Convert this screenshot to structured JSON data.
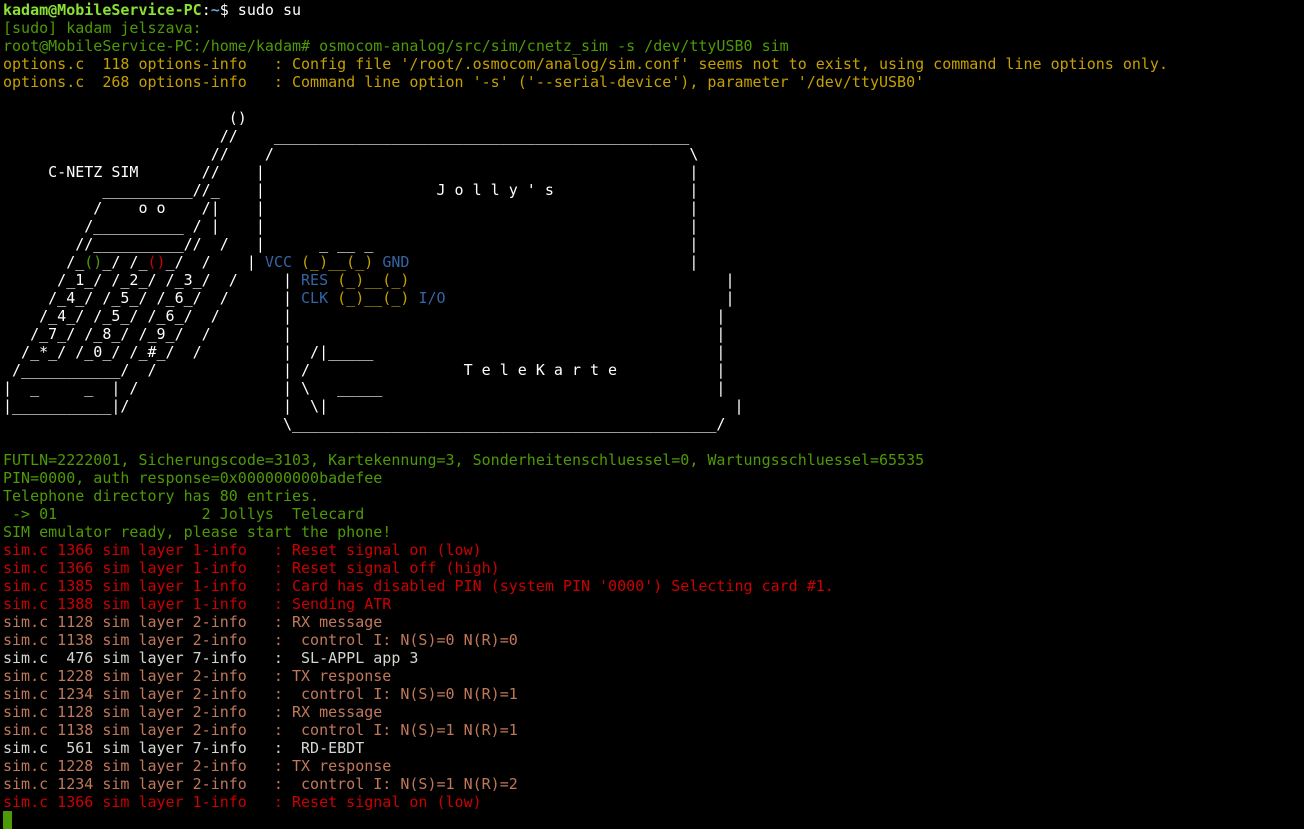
{
  "colors": {
    "default": "#ffffff",
    "green": "#4e9a06",
    "brightgreen": "#8ae234",
    "blue": "#3465a4",
    "brightblue": "#729fcf",
    "orange": "#c4a000",
    "red": "#cc0000",
    "lightred": "#ef2929",
    "gray": "#d3d7cf",
    "salmon": "#c0785a",
    "cursor": "#4e9a06",
    "background": "#000000"
  },
  "terminal": {
    "lines": [
      [
        {
          "t": "kadam@MobileService-PC",
          "c": "brightgreen",
          "b": true
        },
        {
          "t": ":",
          "c": "default"
        },
        {
          "t": "~",
          "c": "brightblue",
          "b": true
        },
        {
          "t": "$ sudo su",
          "c": "default"
        }
      ],
      [
        {
          "t": "[sudo] kadam jelszava:",
          "c": "green"
        }
      ],
      [
        {
          "t": "root@MobileService-PC:/home/kadam# osmocom-analog/src/sim/cnetz_sim -s /dev/ttyUSB0 sim",
          "c": "green"
        }
      ],
      [
        {
          "t": "options.c  118 options-info   : Config file '/root/.osmocom/analog/sim.conf' seems not to exist, using command line options only.",
          "c": "orange"
        }
      ],
      [
        {
          "t": "options.c  268 options-info   : Command line option '-s' ('--serial-device'), parameter '/dev/ttyUSB0'",
          "c": "orange"
        }
      ],
      [
        {
          "t": "",
          "c": "default"
        }
      ],
      [
        {
          "t": "                         ()",
          "c": "default"
        }
      ],
      [
        {
          "t": "                        //    ______________________________________________",
          "c": "default"
        }
      ],
      [
        {
          "t": "                       //    /                                              \\",
          "c": "default"
        }
      ],
      [
        {
          "t": "     C-NETZ SIM       //    |                                               |",
          "c": "default"
        }
      ],
      [
        {
          "t": "           __________//_    |                   J o l l y ' s               |",
          "c": "default"
        }
      ],
      [
        {
          "t": "          /    o o    /|    |                                               |",
          "c": "default"
        }
      ],
      [
        {
          "t": "         /__________ / |    |                                               |",
          "c": "default"
        }
      ],
      [
        {
          "t": "        //__________//  /   |      _ __ _                                   |",
          "c": "default"
        }
      ],
      [
        {
          "t": "       /_",
          "c": "default"
        },
        {
          "t": "()",
          "c": "green"
        },
        {
          "t": "_/ /_",
          "c": "default"
        },
        {
          "t": "()",
          "c": "red"
        },
        {
          "t": "_/  /    ",
          "c": "default"
        },
        {
          "t": "| ",
          "c": "default"
        },
        {
          "t": "VCC ",
          "c": "blue"
        },
        {
          "t": "(_)__(_) ",
          "c": "orange"
        },
        {
          "t": "GND",
          "c": "blue"
        },
        {
          "t": "                               |",
          "c": "default"
        }
      ],
      [
        {
          "t": "      /_1_/ /_2_/ /_3_/  /     ",
          "c": "default"
        },
        {
          "t": "| ",
          "c": "default"
        },
        {
          "t": "RES ",
          "c": "blue"
        },
        {
          "t": "(_)__(_)",
          "c": "orange"
        },
        {
          "t": "                                   |",
          "c": "default"
        }
      ],
      [
        {
          "t": "     /_4_/ /_5_/ /_6_/  /      ",
          "c": "default"
        },
        {
          "t": "| ",
          "c": "default"
        },
        {
          "t": "CLK ",
          "c": "blue"
        },
        {
          "t": "(_)__(_) ",
          "c": "orange"
        },
        {
          "t": "I/O",
          "c": "blue"
        },
        {
          "t": "                               |",
          "c": "default"
        }
      ],
      [
        {
          "t": "    /_4_/ /_5_/ /_6_/  /       |                                               |",
          "c": "default"
        }
      ],
      [
        {
          "t": "   /_7_/ /_8_/ /_9_/  /        |                                               |",
          "c": "default"
        }
      ],
      [
        {
          "t": "  /_*_/ /_0_/ /_#_/  /         |  /|_____                                      |",
          "c": "default"
        }
      ],
      [
        {
          "t": " /___________/  /              | /                 T e l e K a r t e           |",
          "c": "default"
        }
      ],
      [
        {
          "t": "|  _     _  | /                | \\   _____                                     |",
          "c": "default"
        }
      ],
      [
        {
          "t": "|___________|/                 |  \\|                                             |",
          "c": "default"
        }
      ],
      [
        {
          "t": "                               \\_______________________________________________/",
          "c": "default"
        }
      ],
      [
        {
          "t": "",
          "c": "default"
        }
      ],
      [
        {
          "t": "FUTLN=2222001, Sicherungscode=3103, Kartekennung=3, Sonderheitenschluessel=0, Wartungsschluessel=65535",
          "c": "green"
        }
      ],
      [
        {
          "t": "PIN=0000, auth response=0x000000000badefee",
          "c": "green"
        }
      ],
      [
        {
          "t": "Telephone directory has 80 entries.",
          "c": "green"
        }
      ],
      [
        {
          "t": " -> 01                2 Jollys  Telecard",
          "c": "green"
        }
      ],
      [
        {
          "t": "SIM emulator ready, please start the phone!",
          "c": "green"
        }
      ],
      [
        {
          "t": "sim.c 1366 sim layer 1-info   : Reset signal on (low)",
          "c": "red"
        }
      ],
      [
        {
          "t": "sim.c 1366 sim layer 1-info   : Reset signal off (high)",
          "c": "red"
        }
      ],
      [
        {
          "t": "sim.c 1385 sim layer 1-info   : Card has disabled PIN (system PIN '0000') Selecting card #1.",
          "c": "red"
        }
      ],
      [
        {
          "t": "sim.c 1388 sim layer 1-info   : Sending ATR",
          "c": "red"
        }
      ],
      [
        {
          "t": "sim.c 1128 sim layer 2-info   : RX message",
          "c": "salmon"
        }
      ],
      [
        {
          "t": "sim.c 1138 sim layer 2-info   :  control I: N(S)=0 N(R)=0",
          "c": "salmon"
        }
      ],
      [
        {
          "t": "sim.c  476 sim layer 7-info   :  SL-APPL app 3",
          "c": "gray"
        }
      ],
      [
        {
          "t": "sim.c 1228 sim layer 2-info   : TX response",
          "c": "salmon"
        }
      ],
      [
        {
          "t": "sim.c 1234 sim layer 2-info   :  control I: N(S)=0 N(R)=1",
          "c": "salmon"
        }
      ],
      [
        {
          "t": "sim.c 1128 sim layer 2-info   : RX message",
          "c": "salmon"
        }
      ],
      [
        {
          "t": "sim.c 1138 sim layer 2-info   :  control I: N(S)=1 N(R)=1",
          "c": "salmon"
        }
      ],
      [
        {
          "t": "sim.c  561 sim layer 7-info   :  RD-EBDT",
          "c": "gray"
        }
      ],
      [
        {
          "t": "sim.c 1228 sim layer 2-info   : TX response",
          "c": "salmon"
        }
      ],
      [
        {
          "t": "sim.c 1234 sim layer 2-info   :  control I: N(S)=1 N(R)=2",
          "c": "salmon"
        }
      ],
      [
        {
          "t": "sim.c 1366 sim layer 1-info   : Reset signal on (low)",
          "c": "red"
        }
      ]
    ]
  }
}
